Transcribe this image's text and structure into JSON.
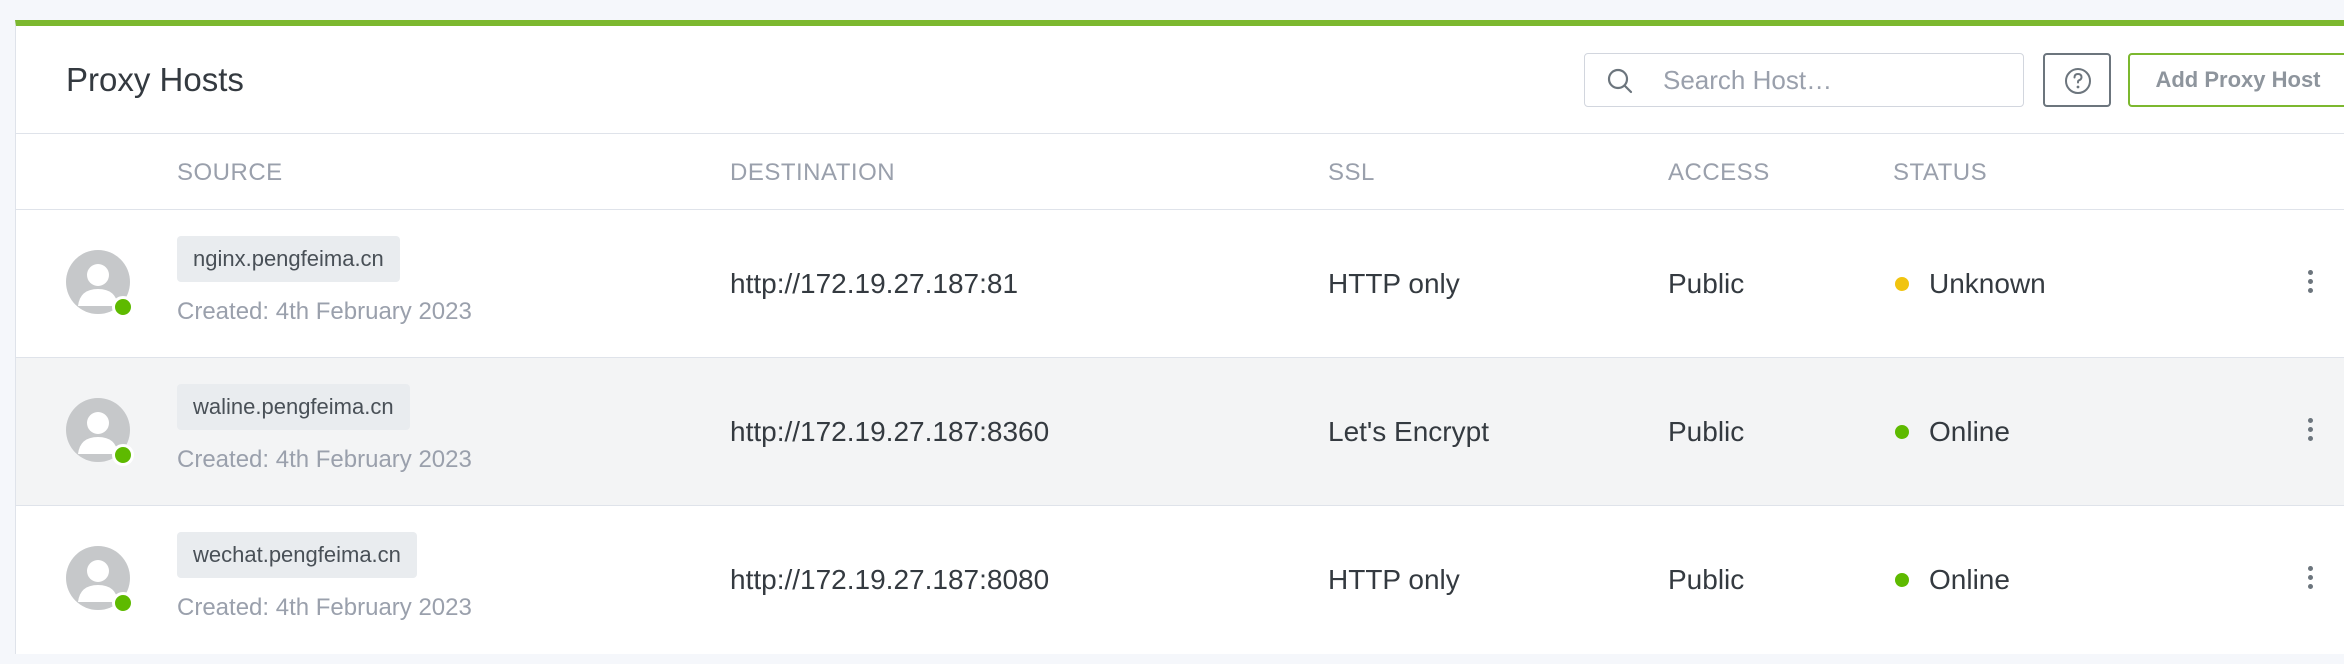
{
  "header": {
    "title": "Proxy Hosts",
    "search_placeholder": "Search Host…",
    "help_icon": "question-circle-icon",
    "add_label": "Add Proxy Host"
  },
  "table": {
    "columns": [
      "SOURCE",
      "DESTINATION",
      "SSL",
      "ACCESS",
      "STATUS"
    ],
    "rows": [
      {
        "domain": "nginx.pengfeima.cn",
        "created": "Created: 4th February 2023",
        "destination": "http://172.19.27.187:81",
        "ssl": "HTTP only",
        "access": "Public",
        "status": "Unknown",
        "status_color": "#f1c40f"
      },
      {
        "domain": "waline.pengfeima.cn",
        "created": "Created: 4th February 2023",
        "destination": "http://172.19.27.187:8360",
        "ssl": "Let's Encrypt",
        "access": "Public",
        "status": "Online",
        "status_color": "#5eba00"
      },
      {
        "domain": "wechat.pengfeima.cn",
        "created": "Created: 4th February 2023",
        "destination": "http://172.19.27.187:8080",
        "ssl": "HTTP only",
        "access": "Public",
        "status": "Online",
        "status_color": "#5eba00"
      }
    ]
  },
  "colors": {
    "accent": "#7cb82f",
    "online": "#5eba00",
    "unknown": "#f1c40f"
  }
}
